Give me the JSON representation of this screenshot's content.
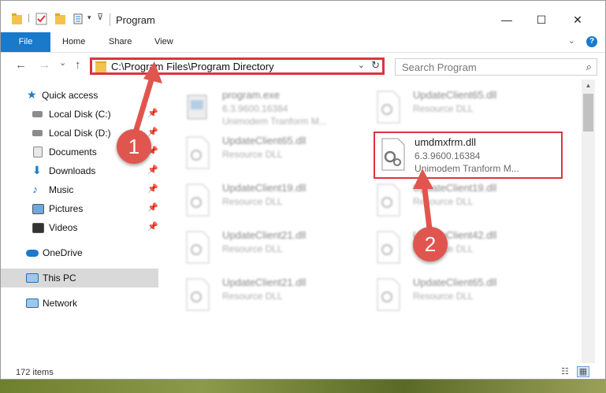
{
  "window": {
    "title": "Program",
    "controls": {
      "minimize": "—",
      "maximize": "☐",
      "close": "✕"
    }
  },
  "ribbon": {
    "tabs": [
      "File",
      "Home",
      "Share",
      "View"
    ],
    "help": "?"
  },
  "navigation": {
    "back": "←",
    "forward": "→",
    "recent": "⌄",
    "up": "↑",
    "address": "C:\\Program Files\\Program Directory",
    "address_dropdown": "⌄",
    "refresh": "↻",
    "search_placeholder": "Search Program",
    "search_icon": "🔍"
  },
  "sidebar": {
    "items": [
      {
        "label": "Quick access",
        "icon": "star-icon",
        "pinned": false
      },
      {
        "label": "Local Disk (C:)",
        "icon": "drive-icon",
        "pinned": true
      },
      {
        "label": "Local Disk (D:)",
        "icon": "drive-icon",
        "pinned": true
      },
      {
        "label": "Documents",
        "icon": "documents-icon",
        "pinned": true
      },
      {
        "label": "Downloads",
        "icon": "download-icon",
        "pinned": true
      },
      {
        "label": "Music",
        "icon": "music-icon",
        "pinned": true
      },
      {
        "label": "Pictures",
        "icon": "pictures-icon",
        "pinned": true
      },
      {
        "label": "Videos",
        "icon": "videos-icon",
        "pinned": true
      },
      {
        "label": "OneDrive",
        "icon": "cloud-icon",
        "pinned": false
      },
      {
        "label": "This PC",
        "icon": "computer-icon",
        "pinned": false,
        "selected": true
      },
      {
        "label": "Network",
        "icon": "network-icon",
        "pinned": false
      }
    ]
  },
  "files": [
    {
      "name": "program.exe",
      "line2": "6.3.9600.16384",
      "line3": "Unimodem Tranform M...",
      "kind": "exe",
      "blurred": true
    },
    {
      "name": "UpdateClient65.dll",
      "line2": "Resource DLL",
      "line3": "",
      "kind": "dll",
      "blurred": true
    },
    {
      "name": "UpdateClient65.dll",
      "line2": "Resource DLL",
      "line3": "",
      "kind": "dll",
      "blurred": true
    },
    {
      "name": "umdmxfrm.dll",
      "line2": "6.3.9600.16384",
      "line3": "Unimodem Tranform M...",
      "kind": "dll",
      "blurred": false,
      "highlighted": true
    },
    {
      "name": "UpdateClient19.dll",
      "line2": "Resource DLL",
      "line3": "",
      "kind": "dll",
      "blurred": true
    },
    {
      "name": "UpdateClient19.dll",
      "line2": "Resource DLL",
      "line3": "",
      "kind": "dll",
      "blurred": true
    },
    {
      "name": "UpdateClient21.dll",
      "line2": "Resource DLL",
      "line3": "",
      "kind": "dll",
      "blurred": true
    },
    {
      "name": "UpdateClient42.dll",
      "line2": "Resource DLL",
      "line3": "",
      "kind": "dll",
      "blurred": true
    },
    {
      "name": "UpdateClient21.dll",
      "line2": "Resource DLL",
      "line3": "",
      "kind": "dll",
      "blurred": true
    },
    {
      "name": "UpdateClient65.dll",
      "line2": "Resource DLL",
      "line3": "",
      "kind": "dll",
      "blurred": true
    }
  ],
  "status": {
    "item_count": "172 items"
  },
  "annotations": {
    "step1": "1",
    "step2": "2",
    "color": "#d9363e"
  },
  "colors": {
    "accent": "#1979ca",
    "highlight": "#d9363e",
    "selected": "#d9d9d9"
  }
}
